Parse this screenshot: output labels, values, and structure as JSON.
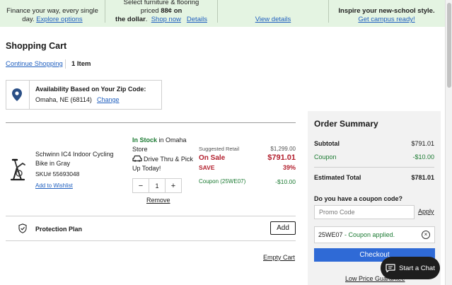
{
  "banner": {
    "cell1_line1": "Finance your way, every single",
    "cell1_line2": "day.",
    "cell1_link": "Explore options",
    "cell2_line1": "Select furniture & flooring",
    "cell2_line2_a": "priced ",
    "cell2_line2_bold": "88¢ on",
    "cell2_line3_bold": "the dollar",
    "cell2_shop_link": "Shop now",
    "cell2_details_link": "Details",
    "cell3_link": "View details",
    "cell4_line1": "Inspire your new-school style.",
    "cell4_link": "Get campus ready!"
  },
  "cart": {
    "title": "Shopping Cart",
    "continue_link": "Continue Shopping",
    "item_count": "1 Item"
  },
  "zip": {
    "title": "Availability Based on Your Zip Code:",
    "location": "Omaha, NE (68114)",
    "change_link": "Change"
  },
  "item": {
    "name": "Schwinn IC4 Indoor Cycling Bike in Gray",
    "sku": "SKU# 55693048",
    "wishlist_link": "Add to Wishlist",
    "stock_status": "In Stock",
    "stock_location": " in Omaha Store",
    "pickup": "Drive Thru & Pick Up Today!",
    "quantity": "1",
    "minus": "−",
    "plus": "+",
    "remove_link": "Remove",
    "suggested_label": "Suggested Retail",
    "suggested_price": "$1,299.00",
    "sale_label": "On Sale",
    "sale_price": "$791.01",
    "save_label": "SAVE",
    "save_percent": "39%",
    "coupon_label": "Coupon (25WE07)",
    "coupon_amount": "-$10.00"
  },
  "protection": {
    "label": "Protection Plan",
    "add_button": "Add"
  },
  "empty_cart_link": "Empty Cart",
  "summary": {
    "title": "Order Summary",
    "subtotal_label": "Subtotal",
    "subtotal_value": "$791.01",
    "coupon_label": "Coupon",
    "coupon_value": "-$10.00",
    "total_label": "Estimated Total",
    "total_value": "$781.01",
    "coupon_question": "Do you have a coupon code?",
    "promo_placeholder": "Promo Code",
    "apply_link": "Apply",
    "applied_code": "25WE07",
    "applied_text": " - Coupon applied.",
    "checkout_button": "Checkout",
    "low_price_link": "Low Price Guarantee"
  },
  "chat": {
    "label": "Start a Chat"
  },
  "colors": {
    "banner_bg": "#e4f4e2",
    "link_blue": "#1f5fbf",
    "sale_red": "#b3202e",
    "stock_green": "#1b7a32",
    "checkout_blue": "#2f6ad6",
    "chat_bg": "#1e1e1e"
  }
}
